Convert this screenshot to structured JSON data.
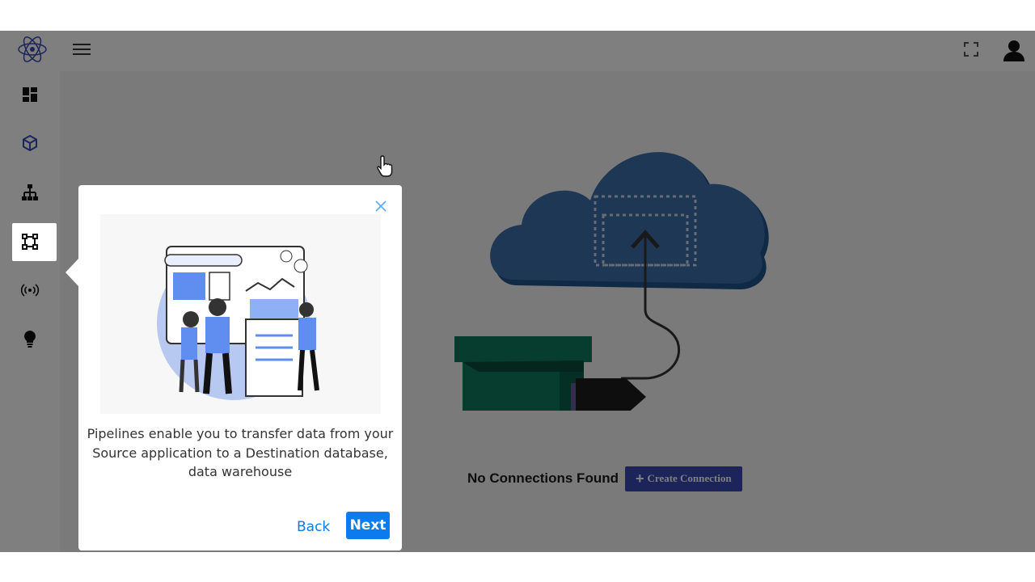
{
  "sidebar": {
    "items": [
      {
        "icon": "dashboard-icon"
      },
      {
        "icon": "cube-icon"
      },
      {
        "icon": "sitemap-icon"
      },
      {
        "icon": "pipeline-icon",
        "active": true
      },
      {
        "icon": "broadcast-icon"
      },
      {
        "icon": "lightbulb-icon"
      }
    ]
  },
  "topbar": {
    "menu_icon": "hamburger-icon",
    "fullscreen_icon": "fullscreen-icon",
    "avatar_icon": "user-icon"
  },
  "main": {
    "empty_text": "No Connections Found",
    "create_label": "Create Connection",
    "create_icon": "+"
  },
  "tour": {
    "description": "Pipelines enable you to transfer data from your Source application to a Destination database, data warehouse",
    "back_label": "Back",
    "next_label": "Next"
  },
  "colors": {
    "accent": "#0b7bf0",
    "create_button": "#3948b5",
    "cloud": "#3d6fa8",
    "box": "#0c7a5d"
  }
}
